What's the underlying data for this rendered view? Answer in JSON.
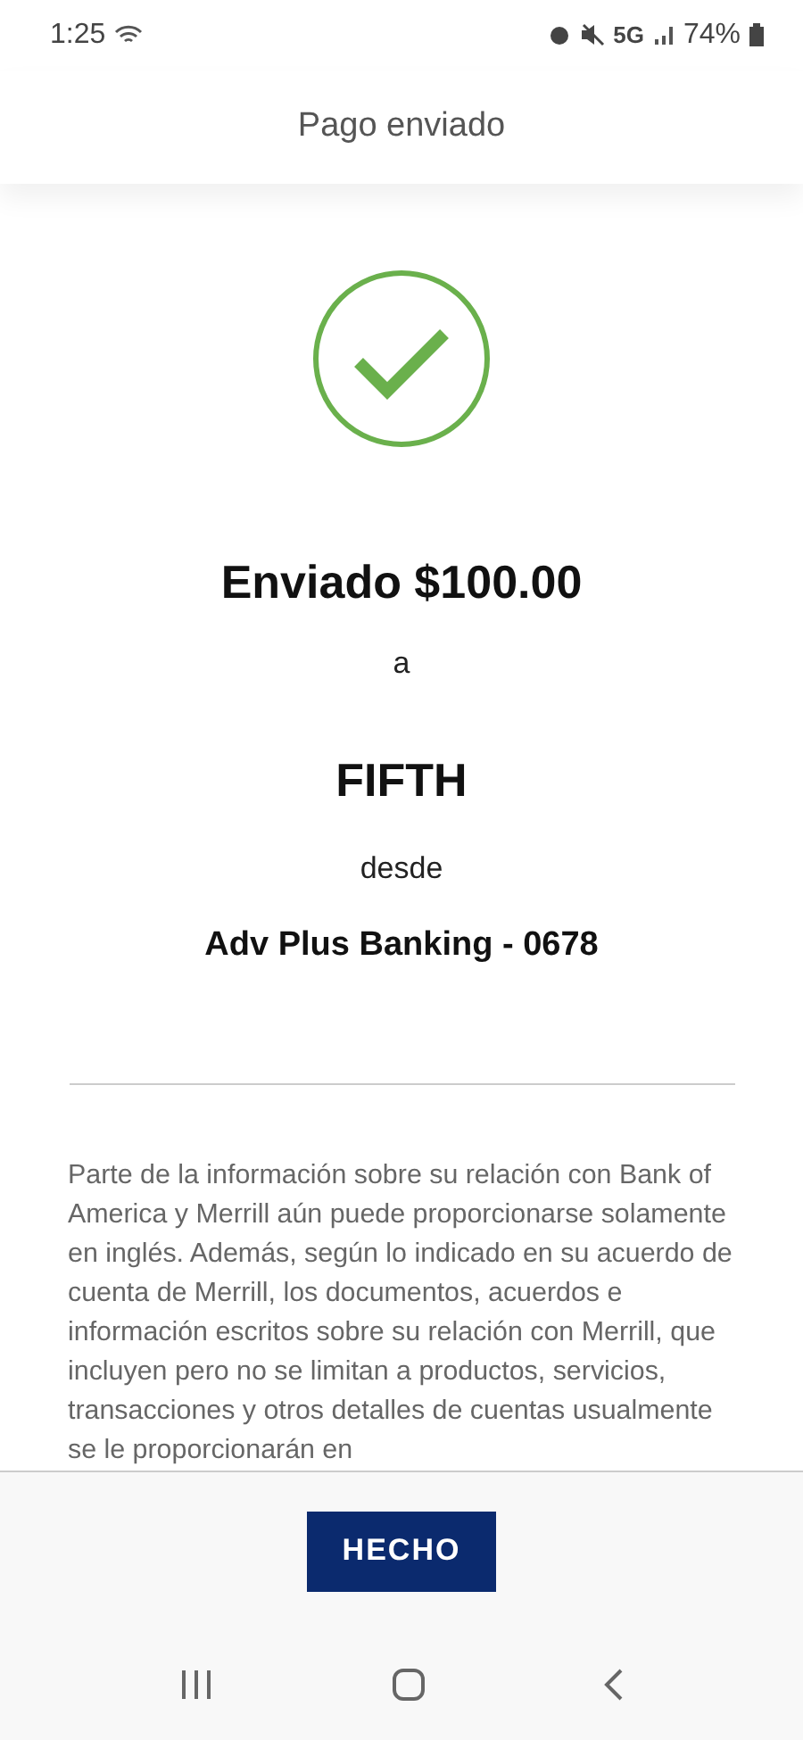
{
  "status_bar": {
    "time": "1:25",
    "network": "5G",
    "battery": "74%"
  },
  "header": {
    "title": "Pago enviado"
  },
  "confirmation": {
    "amount_line": "Enviado $100.00",
    "to_word": "a",
    "recipient": "FIFTH",
    "from_word": "desde",
    "account": "Adv Plus Banking - 0678"
  },
  "disclaimer": "Parte de la información sobre su relación con Bank of America y Merrill aún puede proporcionarse solamente en inglés. Además, según lo indicado en su acuerdo de cuenta de Merrill, los documentos, acuerdos e información escritos sobre su relación con Merrill, que incluyen pero no se limitan a productos, servicios, transacciones y otros detalles de cuentas usualmente se le proporcionarán en",
  "footer": {
    "button": "HECHO"
  }
}
